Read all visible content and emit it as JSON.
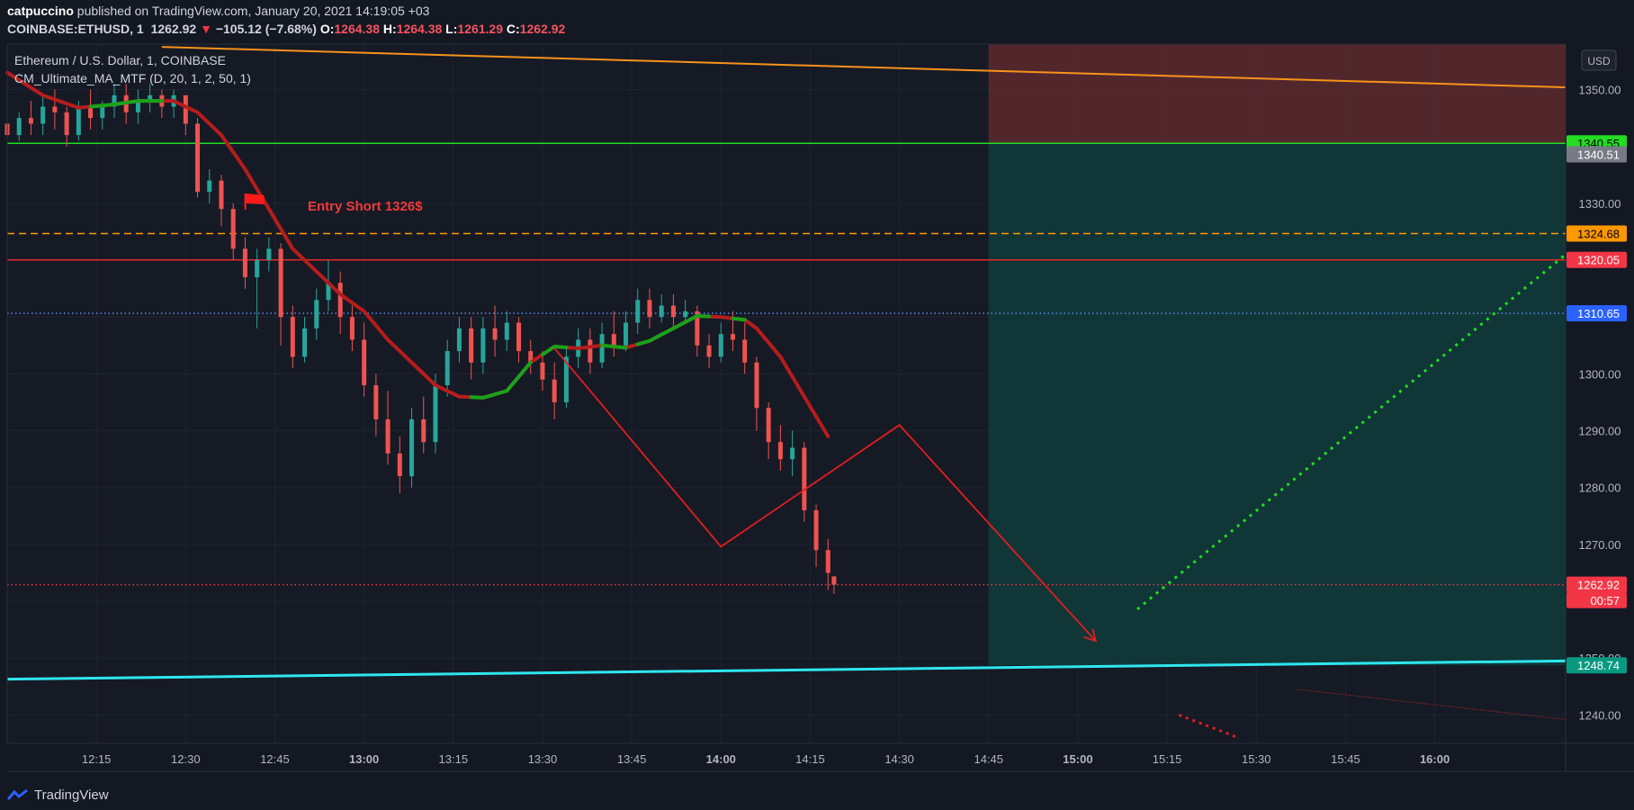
{
  "header": {
    "author": "catpuccino",
    "published_text": "published on TradingView.com, January 20, 2021 14:19:05 +03",
    "symbol": "COINBASE:ETHUSD, 1",
    "last": "1262.92",
    "change": "−105.12 (−7.68%)",
    "o_key": "O:",
    "o_val": "1264.38",
    "h_key": "H:",
    "h_val": "1264.38",
    "l_key": "L:",
    "l_val": "1261.29",
    "c_key": "C:",
    "c_val": "1262.92"
  },
  "legend": {
    "title": "Ethereum / U.S. Dollar, 1, COINBASE",
    "indicator": "CM_Ultimate_MA_MTF (D, 20, 1, 2, 50, 1)"
  },
  "currency_button": "USD",
  "annotation": "Entry Short 1326$",
  "footer": {
    "brand": "TradingView",
    "logo_icon": "tradingview-logo-icon"
  },
  "chart_data": {
    "type": "candlestick",
    "x_tick_labels": [
      "12:15",
      "12:30",
      "12:45",
      "13:00",
      "13:15",
      "13:30",
      "13:45",
      "14:00",
      "14:15",
      "14:30",
      "14:45",
      "15:00",
      "15:15",
      "15:30",
      "15:45",
      "16:00"
    ],
    "x_tick_bold": [
      "13:00",
      "14:00",
      "15:00",
      "16:00"
    ],
    "ylim": [
      1235,
      1358
    ],
    "y_ticks": [
      1240,
      1250,
      1260,
      1270,
      1280,
      1290,
      1300,
      1310,
      1320,
      1330,
      1340,
      1350
    ],
    "y_tick_labels": [
      "1240.00",
      "1250.00",
      "1260.00",
      "1270.00",
      "1280.00",
      "1290.00",
      "1300.00",
      "1310.00",
      "1320.00",
      "1330.00",
      "1340.00",
      "1350.00"
    ],
    "price_badges": [
      {
        "label": "1340.55",
        "value": 1340.55,
        "color": "#22dd22",
        "text": "#000000"
      },
      {
        "label": "1340.51",
        "value": 1338.6,
        "color": "#787b86",
        "text": "#ffffff"
      },
      {
        "label": "1324.68",
        "value": 1324.68,
        "color": "#ff9800",
        "text": "#000000"
      },
      {
        "label": "1320.05",
        "value": 1320.05,
        "color": "#f23645",
        "text": "#ffffff"
      },
      {
        "label": "1310.65",
        "value": 1310.65,
        "color": "#2962ff",
        "text": "#ffffff"
      },
      {
        "label": "1262.92",
        "value": 1262.92,
        "color": "#f23645",
        "text": "#ffffff"
      },
      {
        "label": "00:57",
        "value": 1260.2,
        "color": "#f23645",
        "text": "#ffffff"
      },
      {
        "label": "1248.74",
        "value": 1248.74,
        "color": "#089981",
        "text": "#ffffff"
      }
    ],
    "horizontal_levels": [
      {
        "value": 1340.55,
        "color": "#22dd22",
        "style": "solid"
      },
      {
        "value": 1324.68,
        "color": "#ff9800",
        "style": "dashed"
      },
      {
        "value": 1320.05,
        "color": "#e02a2a",
        "style": "solid"
      },
      {
        "value": 1310.65,
        "color": "#5b8def",
        "style": "dotted"
      },
      {
        "value": 1262.92,
        "color": "#f23645",
        "style": "dotted"
      }
    ],
    "stop_zone": {
      "from_time": "14:45",
      "to": [
        1340.55,
        1358
      ],
      "color": "#5c2a2e"
    },
    "target_zone": {
      "from_time": "14:45",
      "to": [
        1248.74,
        1340.55
      ],
      "color": "#0f3a3a"
    },
    "orange_trendline": [
      {
        "t": "12:26",
        "v": 1357.5
      },
      {
        "t": "16:22",
        "v": 1350.4
      }
    ],
    "cyan_trendline": [
      {
        "t": "12:00",
        "v": 1246.3
      },
      {
        "t": "16:22",
        "v": 1249.5
      }
    ],
    "projection_path": [
      {
        "t": "13:32",
        "v": 1304.5
      },
      {
        "t": "14:00",
        "v": 1269.6
      },
      {
        "t": "14:30",
        "v": 1291.0
      },
      {
        "t": "15:03",
        "v": 1253.0
      }
    ],
    "green_dotted_projection": [
      {
        "t": "15:10",
        "v": 1258.6
      },
      {
        "t": "16:22",
        "v": 1321.0
      }
    ],
    "red_dotted_projection": [
      {
        "t": "15:17",
        "v": 1240.0
      },
      {
        "t": "15:27",
        "v": 1236.0
      }
    ],
    "thin_red_line": [
      {
        "t": "15:37",
        "v": 1244.5
      },
      {
        "t": "16:22",
        "v": 1239.2
      }
    ],
    "entry_flag": {
      "t": "12:42",
      "v": 1329.5
    },
    "candles": [
      {
        "t": "12:00",
        "o": 1344,
        "h": 1347,
        "c": 1342,
        "l": 1340
      },
      {
        "t": "12:02",
        "o": 1342,
        "h": 1346,
        "c": 1345,
        "l": 1341
      },
      {
        "t": "12:04",
        "o": 1345,
        "h": 1348,
        "c": 1344,
        "l": 1342
      },
      {
        "t": "12:06",
        "o": 1344,
        "h": 1349,
        "c": 1347,
        "l": 1342
      },
      {
        "t": "12:08",
        "o": 1347,
        "h": 1350,
        "c": 1346,
        "l": 1343
      },
      {
        "t": "12:10",
        "o": 1346,
        "h": 1347,
        "c": 1342,
        "l": 1340
      },
      {
        "t": "12:12",
        "o": 1342,
        "h": 1348,
        "c": 1347,
        "l": 1341
      },
      {
        "t": "12:14",
        "o": 1347,
        "h": 1350,
        "c": 1345,
        "l": 1343
      },
      {
        "t": "12:16",
        "o": 1345,
        "h": 1348,
        "c": 1347,
        "l": 1343
      },
      {
        "t": "12:18",
        "o": 1347,
        "h": 1351,
        "c": 1349,
        "l": 1345
      },
      {
        "t": "12:20",
        "o": 1349,
        "h": 1351,
        "c": 1346,
        "l": 1344
      },
      {
        "t": "12:22",
        "o": 1346,
        "h": 1350,
        "c": 1348,
        "l": 1344
      },
      {
        "t": "12:24",
        "o": 1348,
        "h": 1351,
        "c": 1349,
        "l": 1346
      },
      {
        "t": "12:26",
        "o": 1349,
        "h": 1350,
        "c": 1347,
        "l": 1345
      },
      {
        "t": "12:28",
        "o": 1347,
        "h": 1350,
        "c": 1349,
        "l": 1345
      },
      {
        "t": "12:30",
        "o": 1349,
        "h": 1349,
        "c": 1344,
        "l": 1342
      },
      {
        "t": "12:32",
        "o": 1344,
        "h": 1345,
        "c": 1332,
        "l": 1331
      },
      {
        "t": "12:34",
        "o": 1332,
        "h": 1336,
        "c": 1334,
        "l": 1330
      },
      {
        "t": "12:36",
        "o": 1334,
        "h": 1335,
        "c": 1329,
        "l": 1326
      },
      {
        "t": "12:38",
        "o": 1329,
        "h": 1330,
        "c": 1322,
        "l": 1320
      },
      {
        "t": "12:40",
        "o": 1322,
        "h": 1324,
        "c": 1317,
        "l": 1315
      },
      {
        "t": "12:42",
        "o": 1317,
        "h": 1322,
        "c": 1320,
        "l": 1308
      },
      {
        "t": "12:44",
        "o": 1320,
        "h": 1324,
        "c": 1322,
        "l": 1318
      },
      {
        "t": "12:46",
        "o": 1322,
        "h": 1323,
        "c": 1310,
        "l": 1305
      },
      {
        "t": "12:48",
        "o": 1310,
        "h": 1312,
        "c": 1303,
        "l": 1301
      },
      {
        "t": "12:50",
        "o": 1303,
        "h": 1310,
        "c": 1308,
        "l": 1302
      },
      {
        "t": "12:52",
        "o": 1308,
        "h": 1315,
        "c": 1313,
        "l": 1306
      },
      {
        "t": "12:54",
        "o": 1313,
        "h": 1320,
        "c": 1316,
        "l": 1311
      },
      {
        "t": "12:56",
        "o": 1316,
        "h": 1318,
        "c": 1310,
        "l": 1307
      },
      {
        "t": "12:58",
        "o": 1310,
        "h": 1312,
        "c": 1306,
        "l": 1304
      },
      {
        "t": "13:00",
        "o": 1306,
        "h": 1309,
        "c": 1298,
        "l": 1296
      },
      {
        "t": "13:02",
        "o": 1298,
        "h": 1300,
        "c": 1292,
        "l": 1289
      },
      {
        "t": "13:04",
        "o": 1292,
        "h": 1297,
        "c": 1286,
        "l": 1284
      },
      {
        "t": "13:06",
        "o": 1286,
        "h": 1289,
        "c": 1282,
        "l": 1279
      },
      {
        "t": "13:08",
        "o": 1282,
        "h": 1294,
        "c": 1292,
        "l": 1280
      },
      {
        "t": "13:10",
        "o": 1292,
        "h": 1296,
        "c": 1288,
        "l": 1286
      },
      {
        "t": "13:12",
        "o": 1288,
        "h": 1300,
        "c": 1298,
        "l": 1286
      },
      {
        "t": "13:14",
        "o": 1298,
        "h": 1306,
        "c": 1304,
        "l": 1296
      },
      {
        "t": "13:16",
        "o": 1304,
        "h": 1310,
        "c": 1308,
        "l": 1302
      },
      {
        "t": "13:18",
        "o": 1308,
        "h": 1310,
        "c": 1302,
        "l": 1299
      },
      {
        "t": "13:20",
        "o": 1302,
        "h": 1310,
        "c": 1308,
        "l": 1300
      },
      {
        "t": "13:22",
        "o": 1308,
        "h": 1312,
        "c": 1306,
        "l": 1303
      },
      {
        "t": "13:24",
        "o": 1306,
        "h": 1311,
        "c": 1309,
        "l": 1304
      },
      {
        "t": "13:26",
        "o": 1309,
        "h": 1310,
        "c": 1304,
        "l": 1302
      },
      {
        "t": "13:28",
        "o": 1304,
        "h": 1306,
        "c": 1302,
        "l": 1300
      },
      {
        "t": "13:30",
        "o": 1302,
        "h": 1304,
        "c": 1299,
        "l": 1297
      },
      {
        "t": "13:32",
        "o": 1299,
        "h": 1302,
        "c": 1295,
        "l": 1292
      },
      {
        "t": "13:34",
        "o": 1295,
        "h": 1305,
        "c": 1303,
        "l": 1294
      },
      {
        "t": "13:36",
        "o": 1303,
        "h": 1308,
        "c": 1306,
        "l": 1301
      },
      {
        "t": "13:38",
        "o": 1306,
        "h": 1308,
        "c": 1302,
        "l": 1300
      },
      {
        "t": "13:40",
        "o": 1302,
        "h": 1309,
        "c": 1307,
        "l": 1301
      },
      {
        "t": "13:42",
        "o": 1307,
        "h": 1311,
        "c": 1305,
        "l": 1303
      },
      {
        "t": "13:44",
        "o": 1305,
        "h": 1311,
        "c": 1309,
        "l": 1304
      },
      {
        "t": "13:46",
        "o": 1309,
        "h": 1315,
        "c": 1313,
        "l": 1307
      },
      {
        "t": "13:48",
        "o": 1313,
        "h": 1315,
        "c": 1310,
        "l": 1308
      },
      {
        "t": "13:50",
        "o": 1310,
        "h": 1314,
        "c": 1312,
        "l": 1309
      },
      {
        "t": "13:52",
        "o": 1312,
        "h": 1314,
        "c": 1310,
        "l": 1308
      },
      {
        "t": "13:54",
        "o": 1310,
        "h": 1313,
        "c": 1311,
        "l": 1309
      },
      {
        "t": "13:56",
        "o": 1311,
        "h": 1312,
        "c": 1305,
        "l": 1303
      },
      {
        "t": "13:58",
        "o": 1305,
        "h": 1307,
        "c": 1303,
        "l": 1301
      },
      {
        "t": "14:00",
        "o": 1303,
        "h": 1309,
        "c": 1307,
        "l": 1302
      },
      {
        "t": "14:02",
        "o": 1307,
        "h": 1311,
        "c": 1306,
        "l": 1304
      },
      {
        "t": "14:04",
        "o": 1306,
        "h": 1309,
        "c": 1302,
        "l": 1300
      },
      {
        "t": "14:06",
        "o": 1302,
        "h": 1303,
        "c": 1294,
        "l": 1290
      },
      {
        "t": "14:08",
        "o": 1294,
        "h": 1295,
        "c": 1288,
        "l": 1285
      },
      {
        "t": "14:10",
        "o": 1288,
        "h": 1291,
        "c": 1285,
        "l": 1283
      },
      {
        "t": "14:12",
        "o": 1285,
        "h": 1290,
        "c": 1287,
        "l": 1282
      },
      {
        "t": "14:14",
        "o": 1287,
        "h": 1288,
        "c": 1276,
        "l": 1274
      },
      {
        "t": "14:16",
        "o": 1276,
        "h": 1277,
        "c": 1269,
        "l": 1266
      },
      {
        "t": "14:18",
        "o": 1269,
        "h": 1271,
        "c": 1265,
        "l": 1262
      },
      {
        "t": "14:19",
        "o": 1264.38,
        "h": 1264.38,
        "c": 1262.92,
        "l": 1261.29
      }
    ],
    "ma": [
      {
        "t": "12:00",
        "v": 1353
      },
      {
        "t": "12:06",
        "v": 1349
      },
      {
        "t": "12:12",
        "v": 1346.8
      },
      {
        "t": "12:18",
        "v": 1347.4
      },
      {
        "t": "12:22",
        "v": 1348
      },
      {
        "t": "12:28",
        "v": 1348
      },
      {
        "t": "12:32",
        "v": 1346
      },
      {
        "t": "12:36",
        "v": 1342
      },
      {
        "t": "12:40",
        "v": 1336
      },
      {
        "t": "12:44",
        "v": 1329
      },
      {
        "t": "12:48",
        "v": 1322
      },
      {
        "t": "12:52",
        "v": 1318
      },
      {
        "t": "12:56",
        "v": 1314
      },
      {
        "t": "13:00",
        "v": 1311
      },
      {
        "t": "13:04",
        "v": 1306
      },
      {
        "t": "13:08",
        "v": 1302
      },
      {
        "t": "13:12",
        "v": 1298
      },
      {
        "t": "13:16",
        "v": 1296
      },
      {
        "t": "13:20",
        "v": 1295.8
      },
      {
        "t": "13:24",
        "v": 1297
      },
      {
        "t": "13:28",
        "v": 1302
      },
      {
        "t": "13:32",
        "v": 1304.8
      },
      {
        "t": "13:36",
        "v": 1304.5
      },
      {
        "t": "13:40",
        "v": 1305
      },
      {
        "t": "13:44",
        "v": 1304.6
      },
      {
        "t": "13:48",
        "v": 1305.8
      },
      {
        "t": "13:52",
        "v": 1308
      },
      {
        "t": "13:56",
        "v": 1310.2
      },
      {
        "t": "14:00",
        "v": 1310
      },
      {
        "t": "14:04",
        "v": 1309.5
      },
      {
        "t": "14:06",
        "v": 1308
      },
      {
        "t": "14:10",
        "v": 1303
      },
      {
        "t": "14:14",
        "v": 1296
      },
      {
        "t": "14:18",
        "v": 1289
      }
    ],
    "ma_rising_segments": [
      [
        "12:14",
        "12:26"
      ],
      [
        "13:18",
        "13:28"
      ],
      [
        "13:30",
        "13:34"
      ],
      [
        "13:40",
        "13:44"
      ],
      [
        "13:46",
        "13:58"
      ],
      [
        "14:02",
        "14:04"
      ]
    ],
    "colors": {
      "up": "#26a69a",
      "down": "#ef5350",
      "ma_down": "#b71c1c",
      "ma_up": "#1aa31a"
    }
  }
}
